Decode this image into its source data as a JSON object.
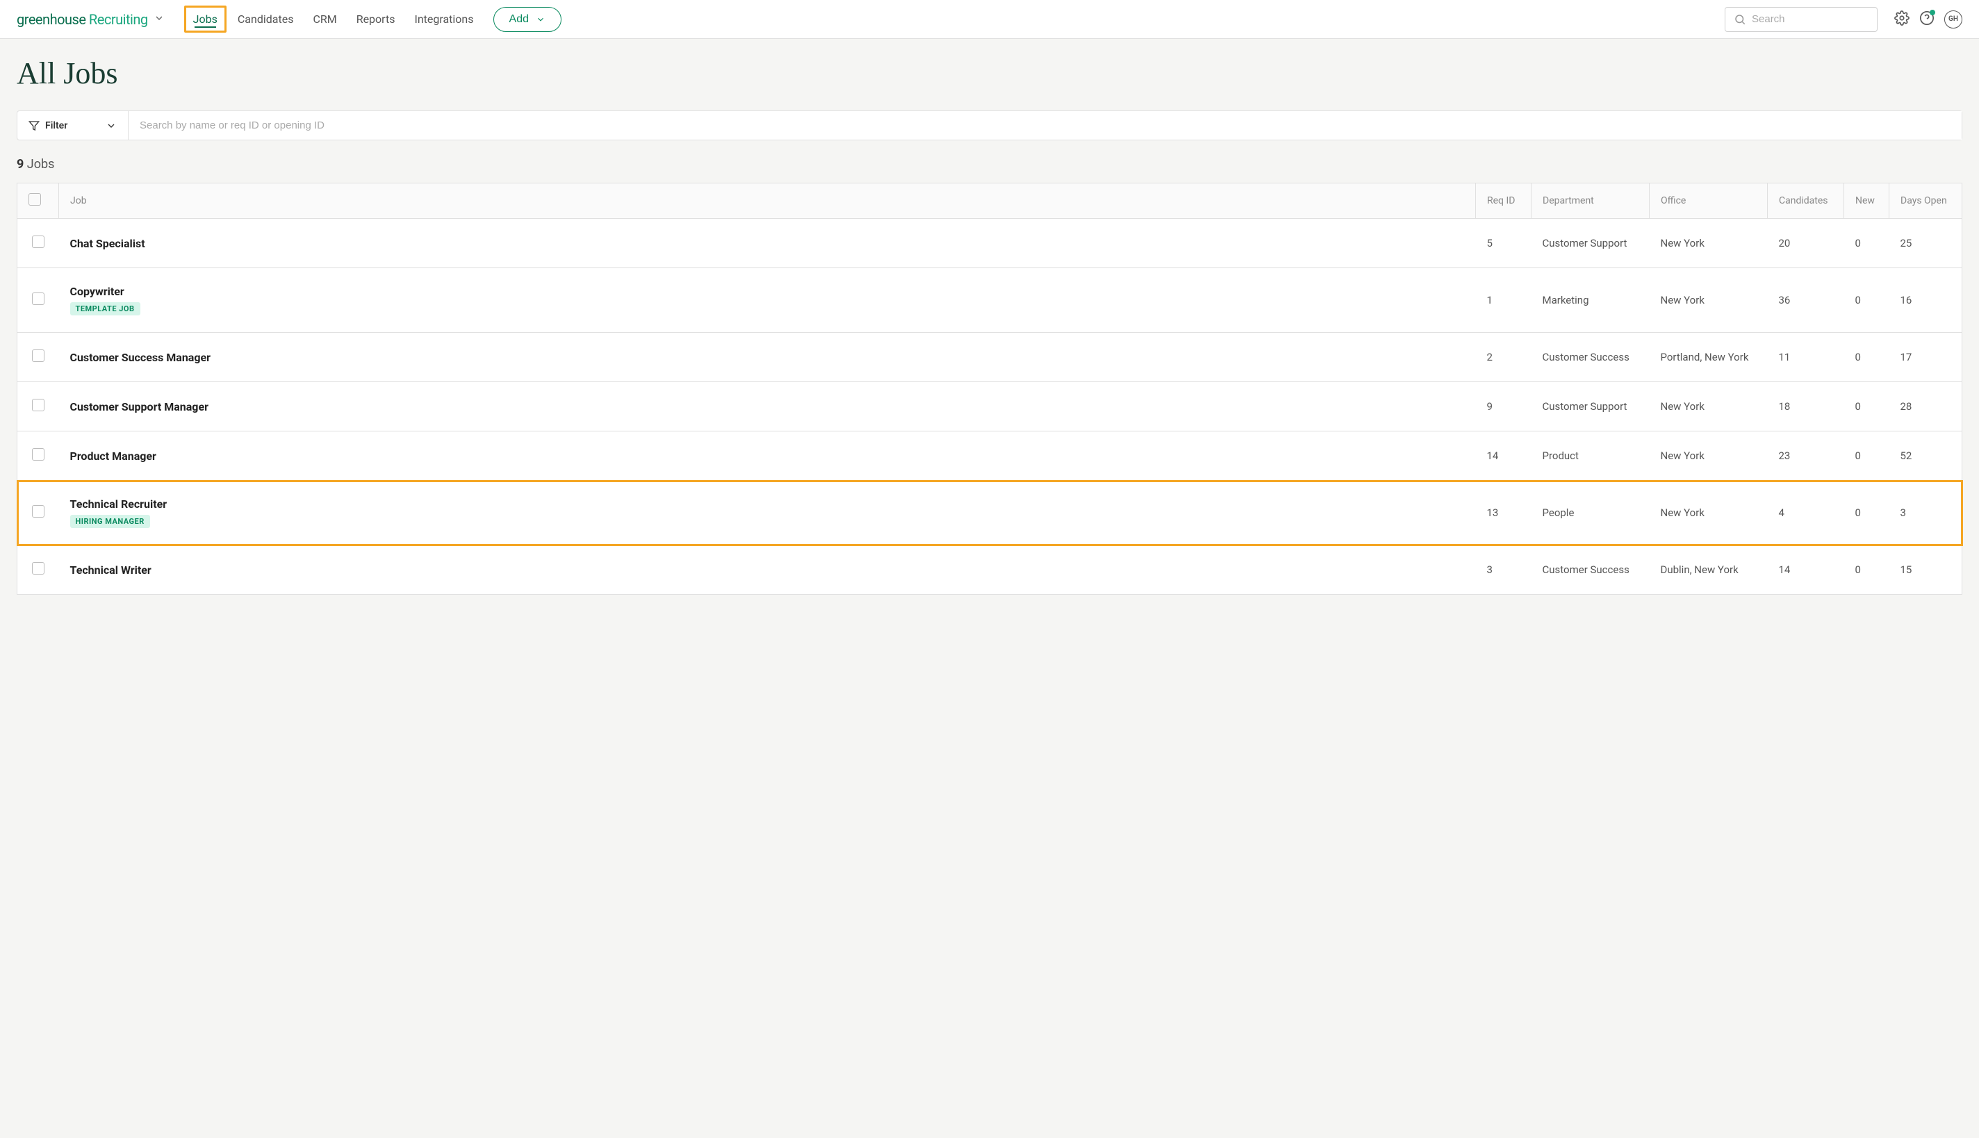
{
  "header": {
    "logo_prefix": "greenhouse",
    "logo_suffix": " Recruiting",
    "nav": {
      "jobs": "Jobs",
      "candidates": "Candidates",
      "crm": "CRM",
      "reports": "Reports",
      "integrations": "Integrations"
    },
    "add_label": "Add",
    "search_placeholder": "Search",
    "avatar_initials": "GH"
  },
  "page": {
    "title": "All Jobs",
    "filter_label": "Filter",
    "filter_search_placeholder": "Search by name or req ID or opening ID",
    "jobs_count": "9",
    "jobs_count_label": "Jobs"
  },
  "table": {
    "headers": {
      "job": "Job",
      "reqid": "Req ID",
      "department": "Department",
      "office": "Office",
      "candidates": "Candidates",
      "new": "New",
      "days_open": "Days Open"
    },
    "rows": [
      {
        "name": "Chat Specialist",
        "badge": "",
        "reqid": "5",
        "department": "Customer Support",
        "office": "New York",
        "candidates": "20",
        "new_count": "0",
        "days_open": "25",
        "highlight": false
      },
      {
        "name": "Copywriter",
        "badge": "TEMPLATE JOB",
        "reqid": "1",
        "department": "Marketing",
        "office": "New York",
        "candidates": "36",
        "new_count": "0",
        "days_open": "16",
        "highlight": false
      },
      {
        "name": "Customer Success Manager",
        "badge": "",
        "reqid": "2",
        "department": "Customer Success",
        "office": "Portland, New York",
        "candidates": "11",
        "new_count": "0",
        "days_open": "17",
        "highlight": false
      },
      {
        "name": "Customer Support Manager",
        "badge": "",
        "reqid": "9",
        "department": "Customer Support",
        "office": "New York",
        "candidates": "18",
        "new_count": "0",
        "days_open": "28",
        "highlight": false
      },
      {
        "name": "Product Manager",
        "badge": "",
        "reqid": "14",
        "department": "Product",
        "office": "New York",
        "candidates": "23",
        "new_count": "0",
        "days_open": "52",
        "highlight": false
      },
      {
        "name": "Technical Recruiter",
        "badge": "HIRING MANAGER",
        "reqid": "13",
        "department": "People",
        "office": "New York",
        "candidates": "4",
        "new_count": "0",
        "days_open": "3",
        "highlight": true
      },
      {
        "name": "Technical Writer",
        "badge": "",
        "reqid": "3",
        "department": "Customer Success",
        "office": "Dublin, New York",
        "candidates": "14",
        "new_count": "0",
        "days_open": "15",
        "highlight": false
      }
    ]
  }
}
